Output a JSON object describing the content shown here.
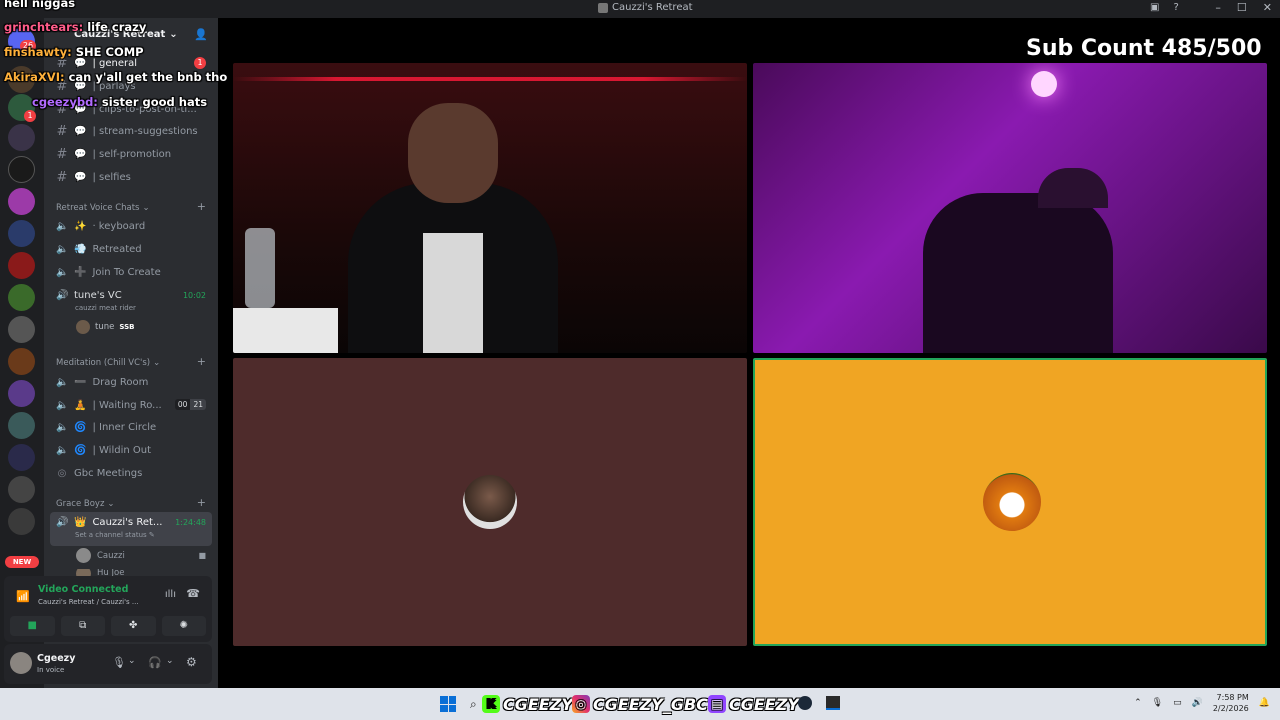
{
  "window": {
    "title": "Cauzzi's Retreat"
  },
  "server": {
    "name": "Cauzzi's Retreat"
  },
  "text_channels": [
    {
      "name": "| general",
      "emoji": "💬",
      "badge": "1"
    },
    {
      "name": "| parlays",
      "emoji": "💬"
    },
    {
      "name": "| clips-to-post-on-ti...",
      "emoji": "💬"
    },
    {
      "name": "| stream-suggestions",
      "emoji": "💬"
    },
    {
      "name": "| self-promotion",
      "emoji": "💬"
    },
    {
      "name": "| selfies",
      "emoji": "💬"
    }
  ],
  "categories": {
    "retreat_voice": "Retreat Voice Chats",
    "meditation": "Meditation (Chill VC's)",
    "grace_boyz": "Grace Boyz"
  },
  "voice_channels_a": [
    {
      "name": "· keyboard",
      "emoji": "✨"
    },
    {
      "name": "Retreated",
      "emoji": "💨"
    },
    {
      "name": "Join To Create",
      "emoji": "➕"
    }
  ],
  "tunes_vc": {
    "name": "tune's VC",
    "time": "10:02",
    "status": "cauzzi meat rider",
    "member": "tune",
    "member_tag": "SSB"
  },
  "voice_channels_b": [
    {
      "name": "Drag Room",
      "emoji": "➖"
    },
    {
      "name": "| Waiting Ro...",
      "emoji": "🧘",
      "counts": [
        "00",
        "21"
      ]
    },
    {
      "name": "| Inner Circle",
      "emoji": "🌀"
    },
    {
      "name": "| Wildin Out",
      "emoji": "🌀"
    },
    {
      "name": "Gbc Meetings",
      "emoji": ""
    }
  ],
  "active_vc": {
    "name": "Cauzzi's Ret...",
    "time": "1:24:48",
    "status": "Set a channel status",
    "members": [
      "Cauzzi",
      "Hu Joe"
    ]
  },
  "new_badge": "NEW",
  "server_badges": {
    "notif": "26",
    "dm": "1"
  },
  "voice_panel": {
    "status": "Video Connected",
    "location": "Cauzzi's Retreat / Cauzzi's ..."
  },
  "user": {
    "name": "Cgeezy",
    "status": "In voice"
  },
  "overlay": {
    "sub_count": "Sub Count 485/500",
    "chat": [
      {
        "user": "hell niggas",
        "msg": "",
        "color": "#ffffff"
      },
      {
        "user": "grinchtears:",
        "msg": "life crazy",
        "color": "#ff5c8a"
      },
      {
        "user": "finshawty:",
        "msg": "SHE COMP",
        "color": "#ffb13b"
      },
      {
        "user": "AkiraXVI:",
        "msg": "can y'all get the bnb tho",
        "color": "#ffb13b"
      },
      {
        "user": "cgeezybd:",
        "msg": "sister good hats",
        "color": "#b26bff"
      }
    ]
  },
  "taskbar": {
    "kick": "CGEEZY",
    "instagram": "CGEEZY_GBC",
    "twitch": "CGEEZY",
    "time": "7:58 PM",
    "date": "2/2/2026"
  },
  "colors": {
    "tile_brown": "#4e2b2b",
    "tile_orange": "#f0a523",
    "speaking_green": "#23a55a"
  }
}
